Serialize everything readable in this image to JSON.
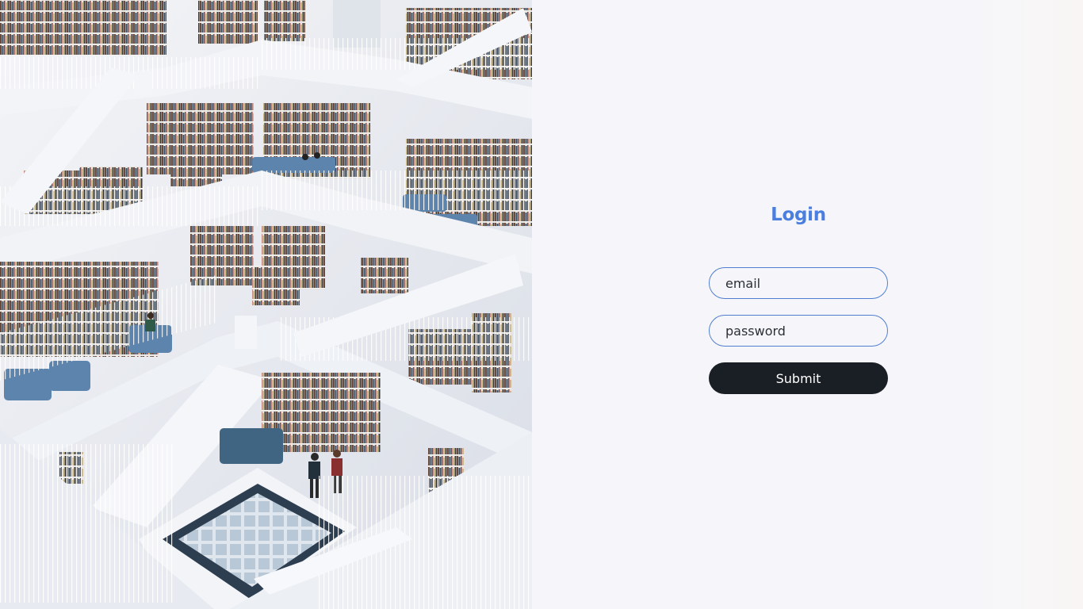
{
  "login": {
    "title": "Login",
    "email_placeholder": "email",
    "password_placeholder": "password",
    "submit_label": "Submit"
  },
  "colors": {
    "title": "#4a7fe0",
    "field_border": "#4f7ed0",
    "button_bg": "#1a1f26",
    "panel_bg": "#f6f6fa"
  }
}
